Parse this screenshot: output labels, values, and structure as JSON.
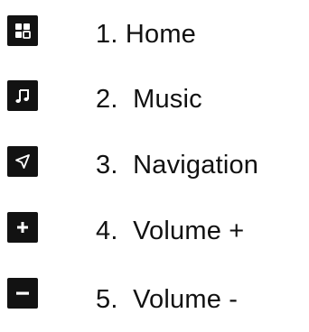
{
  "menu": {
    "items": [
      {
        "label": "1. Home",
        "icon": "home-grid-icon"
      },
      {
        "label": "2.  Music",
        "icon": "music-note-icon"
      },
      {
        "label": "3.  Navigation",
        "icon": "navigation-arrow-icon"
      },
      {
        "label": "4.  Volume +",
        "icon": "volume-plus-icon"
      },
      {
        "label": "5.  Volume -",
        "icon": "volume-minus-icon"
      }
    ]
  },
  "colors": {
    "icon_background": "#121212",
    "icon_foreground": "#ffffff",
    "text": "#111111",
    "page_background": "#ffffff"
  }
}
